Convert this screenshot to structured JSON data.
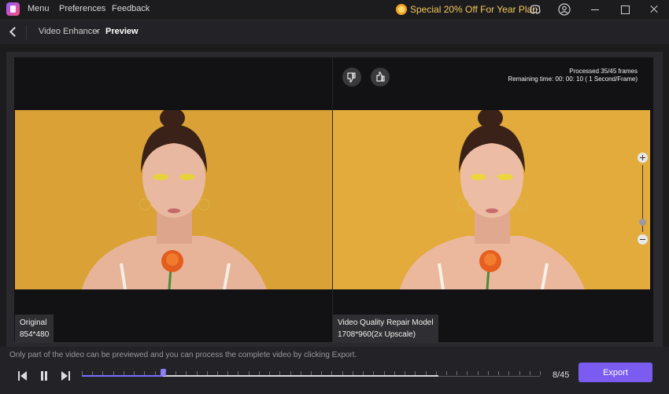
{
  "titlebar": {
    "menu": [
      "Menu",
      "Preferences",
      "Feedback"
    ],
    "promo": "Special 20% Off For Year Plan",
    "icons": [
      "discord-icon",
      "account-icon"
    ],
    "window_buttons": [
      "minimize",
      "maximize",
      "close"
    ]
  },
  "breadcrumb": {
    "items": [
      "Video Enhancer",
      "Preview"
    ],
    "separator": "›"
  },
  "preview": {
    "processed": "Processed 35/45 frames",
    "remaining": "Remaining time: 00: 00: 10 ( 1 Second/Frame)",
    "left": {
      "title": "Original",
      "resolution": "854*480"
    },
    "right": {
      "title": "Video Quality Repair Model",
      "resolution": "1708*960(2x Upscale)"
    },
    "zoom_level": 0.1
  },
  "bottom": {
    "notice": "Only part of the video can be previewed and you can process the complete video by clicking Export.",
    "frame_counter": "8/45",
    "export_label": "Export",
    "current_frame": 8,
    "processed_frames": 35,
    "total_frames": 45
  },
  "colors": {
    "accent": "#7a5cf0",
    "promo": "#f5c85a",
    "background": "#1c1c1f",
    "photo_background": "#e0a83a"
  }
}
